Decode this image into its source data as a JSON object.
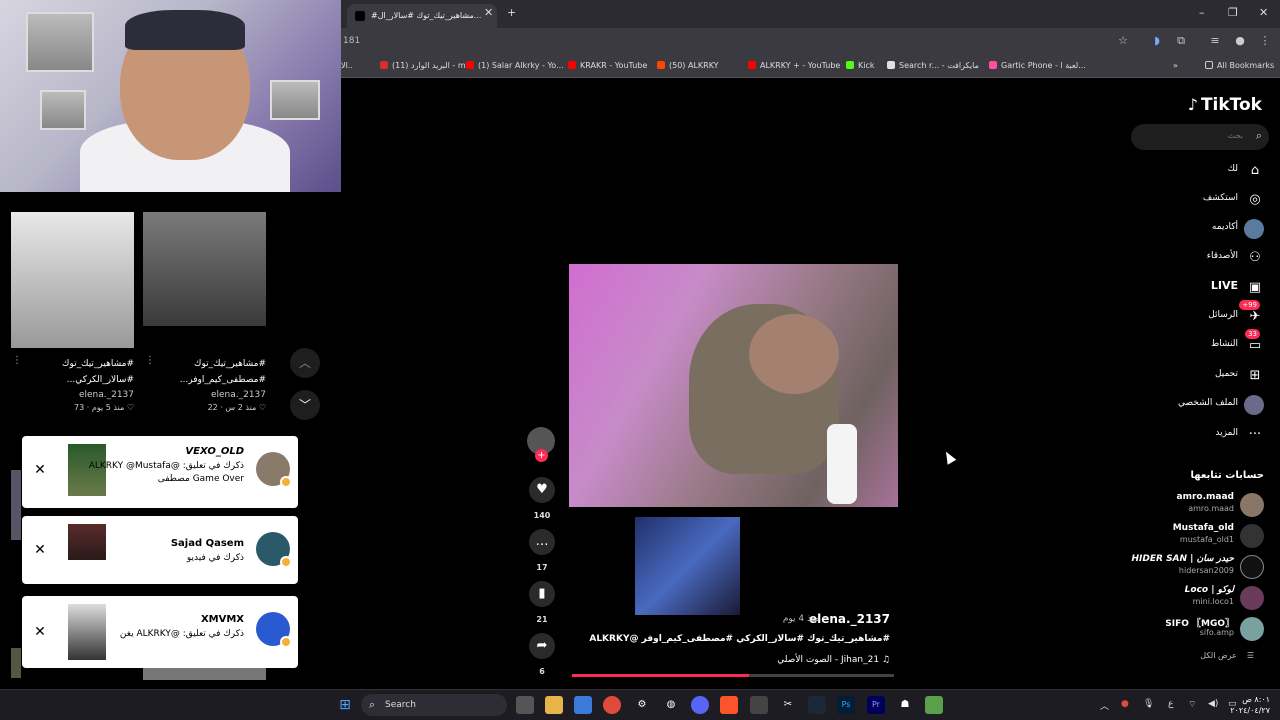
{
  "browser": {
    "tab_title": "#مشاهير_تيك_توك #سالار_ال...",
    "address": "181",
    "bookmarks": [
      {
        "label": "الا..",
        "color": "#888888"
      },
      {
        "label": "(11) البريد الوارد - m...",
        "color": "#d93025"
      },
      {
        "label": "(1) Salar Alkrky - Yo...",
        "color": "#ff0000"
      },
      {
        "label": "KRAKR - YouTube",
        "color": "#ff0000"
      },
      {
        "label": "(50) ALKRKY",
        "color": "#ff4500"
      },
      {
        "label": "ALKRKY + - YouTube",
        "color": "#ff0000"
      },
      {
        "label": "Kick",
        "color": "#53fc18"
      },
      {
        "label": "Search r... - مايكرافت",
        "color": "#e0e0e0"
      },
      {
        "label": "Gartic Phone - لعبة ا...",
        "color": "#ff4fa0"
      }
    ],
    "all_bookmarks": "All Bookmarks"
  },
  "left_feed": {
    "videos": [
      {
        "title1": "#مشاهير_تيك_توك",
        "title2": "#سالار_الكركي...",
        "user": "elena._2137",
        "likes": "73",
        "age": "منذ 5 يوم"
      },
      {
        "title1": "#مشاهير_تيك_توك",
        "title2": "#مصطفى_كيم_اوفر...",
        "user": "elena._2137",
        "likes": "22",
        "age": "منذ 2 س"
      }
    ]
  },
  "notifications": [
    {
      "name": "VEXO_OLD",
      "message": "ذكرك في تعليق: @ALKRKY @Mustafa Game Over مصطفى"
    },
    {
      "name": "Sajad Qasem",
      "message": "ذكرك في فيديو"
    },
    {
      "name": "XMVMX",
      "message": "ذكرك في تعليق: @ALKRKY يغن"
    }
  ],
  "video": {
    "user": "elena._2137",
    "meta": "منذ 4 يوم ·",
    "caption": "#مشاهير_تيك_توك #سالار_الكركي #مصطفى_كيم_اوفر @ALKRKY",
    "sound": "♫ Jihan_21 - الصوت الأصلي",
    "progress": 0.55,
    "likes": "140",
    "comments": "17",
    "saves": "21",
    "shares": "6"
  },
  "sidebar": {
    "logo": "TikTok",
    "search_placeholder": "بحث",
    "nav": [
      {
        "label": "لك",
        "icon": "home-icon",
        "glyph": "⌂"
      },
      {
        "label": "استكشف",
        "icon": "compass-icon",
        "glyph": "◎"
      },
      {
        "label": "أكاديمه",
        "icon": "avatar-icon",
        "glyph": ""
      },
      {
        "label": "الأصدقاء",
        "icon": "friends-icon",
        "glyph": "👥"
      },
      {
        "label": "LIVE",
        "icon": "live-icon",
        "glyph": "▣"
      },
      {
        "label": "الرسائل",
        "icon": "messages-icon",
        "glyph": "✈",
        "badge": "+99"
      },
      {
        "label": "النشاط",
        "icon": "activity-icon",
        "glyph": "▭",
        "badge": "33"
      },
      {
        "label": "تحميل",
        "icon": "upload-icon",
        "glyph": "⊞"
      },
      {
        "label": "الملف الشخصي",
        "icon": "profile-icon",
        "glyph": ""
      },
      {
        "label": "المزيد",
        "icon": "more-icon",
        "glyph": "···"
      }
    ],
    "following_title": "حسابات تتابعها",
    "following": [
      {
        "name": "amro.maad",
        "handle": "amro.maad"
      },
      {
        "name": "Mustafa_old",
        "handle": "mustafa_old1"
      },
      {
        "name": "HIDER SAN | حيدر سان",
        "handle": "hidersan2009"
      },
      {
        "name": "Loco | لوكو",
        "handle": "mini.loco1"
      },
      {
        "name": "SIFO 〖MGO〗",
        "handle": "sifo.amp"
      }
    ],
    "see_all": "عرض الكل"
  },
  "taskbar": {
    "search": "Search",
    "lang": "ع",
    "time": "٨:٠١ ص",
    "date": "٢٠٢٤/٠٤/٢٧"
  }
}
